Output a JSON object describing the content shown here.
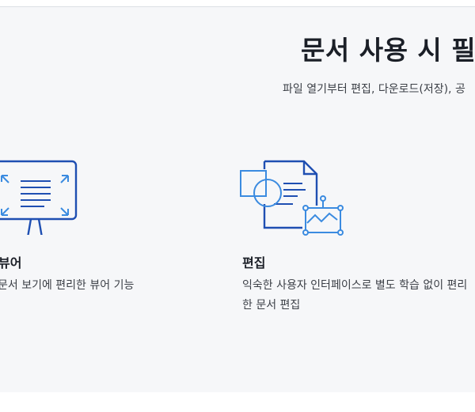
{
  "section": {
    "title": "문서 사용 시 필수",
    "subtitle": "파일 열기부터 편집, 다운로드(저장), 공"
  },
  "cards": [
    {
      "title": "뷰어",
      "description": "문서 보기에 편리한 뷰어 기능",
      "icon": "monitor-expand-icon"
    },
    {
      "title": "편집",
      "description": "익숙한 사용자 인터페이스로 별도 학습 없이 편리한 문서 편집",
      "icon": "document-edit-icon"
    }
  ],
  "colors": {
    "background": "#f6f7f9",
    "icon_dark_blue": "#1f4fb2",
    "icon_light_blue": "#3b8be0",
    "title_text": "#1b1f27",
    "body_text": "#3b3f46"
  }
}
